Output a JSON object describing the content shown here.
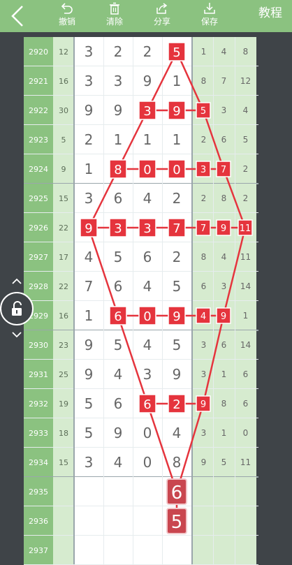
{
  "toolbar": {
    "undo_label": "撤销",
    "clear_label": "清除",
    "share_label": "分享",
    "save_label": "保存",
    "tutorial_label": "教程"
  },
  "rows": [
    {
      "issue": "2920",
      "sum": "12",
      "digits": [
        "3",
        "2",
        "2",
        "5"
      ],
      "spans": [
        "1",
        "4",
        "8"
      ]
    },
    {
      "issue": "2921",
      "sum": "16",
      "digits": [
        "3",
        "3",
        "9",
        "1"
      ],
      "spans": [
        "8",
        "7",
        "12"
      ]
    },
    {
      "issue": "2922",
      "sum": "30",
      "digits": [
        "9",
        "9",
        "3",
        "9"
      ],
      "spans": [
        "5",
        "3",
        "4"
      ]
    },
    {
      "issue": "2923",
      "sum": "5",
      "digits": [
        "2",
        "1",
        "1",
        "1"
      ],
      "spans": [
        "2",
        "6",
        "5"
      ]
    },
    {
      "issue": "2924",
      "sum": "9",
      "digits": [
        "1",
        "8",
        "0",
        "0"
      ],
      "spans": [
        "3",
        "7",
        "2"
      ]
    },
    {
      "issue": "2925",
      "sum": "15",
      "digits": [
        "3",
        "6",
        "4",
        "2"
      ],
      "spans": [
        "2",
        "8",
        "2"
      ]
    },
    {
      "issue": "2926",
      "sum": "22",
      "digits": [
        "9",
        "3",
        "3",
        "7"
      ],
      "spans": [
        "7",
        "9",
        "11"
      ]
    },
    {
      "issue": "2927",
      "sum": "17",
      "digits": [
        "4",
        "5",
        "6",
        "2"
      ],
      "spans": [
        "8",
        "4",
        "11"
      ]
    },
    {
      "issue": "2928",
      "sum": "22",
      "digits": [
        "7",
        "6",
        "4",
        "5"
      ],
      "spans": [
        "6",
        "3",
        "14"
      ]
    },
    {
      "issue": "2929",
      "sum": "16",
      "digits": [
        "1",
        "6",
        "0",
        "9"
      ],
      "spans": [
        "4",
        "9",
        "1"
      ]
    },
    {
      "issue": "2930",
      "sum": "23",
      "digits": [
        "9",
        "5",
        "4",
        "5"
      ],
      "spans": [
        "3",
        "6",
        "14"
      ]
    },
    {
      "issue": "2931",
      "sum": "25",
      "digits": [
        "9",
        "4",
        "3",
        "9"
      ],
      "spans": [
        "3",
        "1",
        "6"
      ]
    },
    {
      "issue": "2932",
      "sum": "19",
      "digits": [
        "5",
        "6",
        "6",
        "2"
      ],
      "spans": [
        "9",
        "8",
        "6"
      ]
    },
    {
      "issue": "2933",
      "sum": "18",
      "digits": [
        "5",
        "9",
        "0",
        "4"
      ],
      "spans": [
        "3",
        "1",
        "0"
      ]
    },
    {
      "issue": "2934",
      "sum": "15",
      "digits": [
        "3",
        "4",
        "0",
        "8"
      ],
      "spans": [
        "9",
        "5",
        "11"
      ]
    },
    {
      "issue": "2935",
      "sum": "",
      "digits": [
        "",
        "",
        "",
        ""
      ],
      "spans": [
        "",
        "",
        ""
      ]
    },
    {
      "issue": "2936",
      "sum": "",
      "digits": [
        "",
        "",
        "",
        ""
      ],
      "spans": [
        "",
        "",
        ""
      ]
    },
    {
      "issue": "2937",
      "sum": "",
      "digits": [
        "",
        "",
        "",
        ""
      ],
      "spans": [
        "",
        "",
        ""
      ]
    }
  ],
  "prediction": {
    "row_2935": "6",
    "row_2936": "5"
  },
  "marker_color": "#e5343d",
  "line_color": "#e5343d"
}
